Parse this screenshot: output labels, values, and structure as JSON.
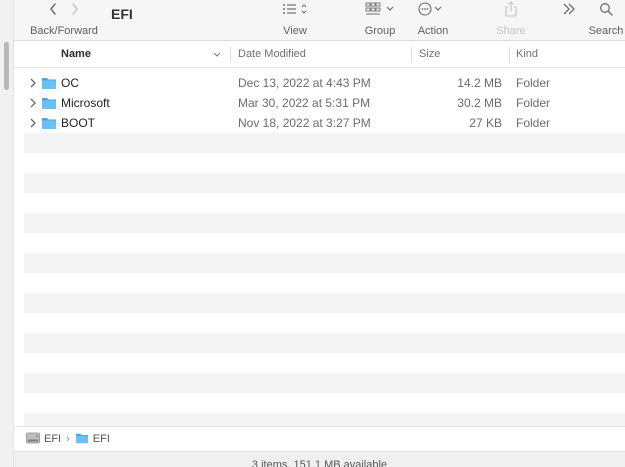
{
  "toolbar": {
    "nav_label": "Back/Forward",
    "title": "EFI",
    "view_label": "View",
    "group_label": "Group",
    "action_label": "Action",
    "share_label": "Share",
    "search_label": "Search"
  },
  "columns": {
    "name": "Name",
    "date": "Date Modified",
    "size": "Size",
    "kind": "Kind"
  },
  "files": [
    {
      "name": "OC",
      "date": "Dec 13, 2022 at 4:43 PM",
      "size": "14.2 MB",
      "kind": "Folder"
    },
    {
      "name": "Microsoft",
      "date": "Mar 30, 2022 at 5:31 PM",
      "size": "30.2 MB",
      "kind": "Folder"
    },
    {
      "name": "BOOT",
      "date": "Nov 18, 2022 at 3:27 PM",
      "size": "27 KB",
      "kind": "Folder"
    }
  ],
  "pathbar": {
    "drive": "EFI",
    "folder": "EFI"
  },
  "status": "3 items, 151.1 MB available",
  "colors": {
    "folder": "#5fb7ef",
    "folder_tab": "#4ba4e0",
    "stripe": "#f4f4f4",
    "toolbar_bg": "#f6f6f6"
  }
}
